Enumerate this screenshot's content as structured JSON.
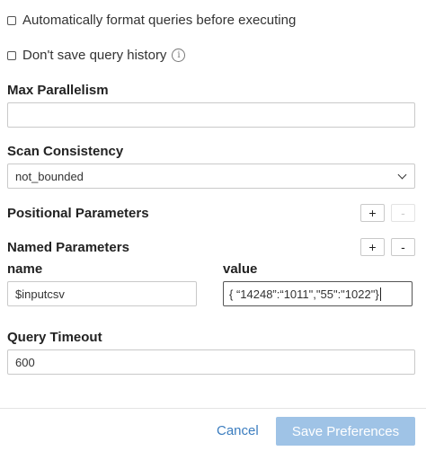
{
  "options": {
    "auto_format_label": "Automatically format queries before executing",
    "no_history_label": "Don't save query history",
    "info_icon": "i"
  },
  "max_parallelism": {
    "label": "Max Parallelism",
    "value": ""
  },
  "scan_consistency": {
    "label": "Scan Consistency",
    "selected": "not_bounded"
  },
  "positional_parameters": {
    "label": "Positional Parameters",
    "add": "+",
    "remove": "-"
  },
  "named_parameters": {
    "label": "Named Parameters",
    "add": "+",
    "remove": "-",
    "name_header": "name",
    "value_header": "value",
    "name_value": "$inputcsv",
    "value_value": "{ “14248”:“1011\",\"55\":\"1022\"}"
  },
  "query_timeout": {
    "label": "Query Timeout",
    "value": "600"
  },
  "footer": {
    "cancel_label": "Cancel",
    "save_label": "Save Preferences"
  },
  "colors": {
    "link": "#3b7dbf",
    "primary_disabled": "#9fc3e6"
  }
}
